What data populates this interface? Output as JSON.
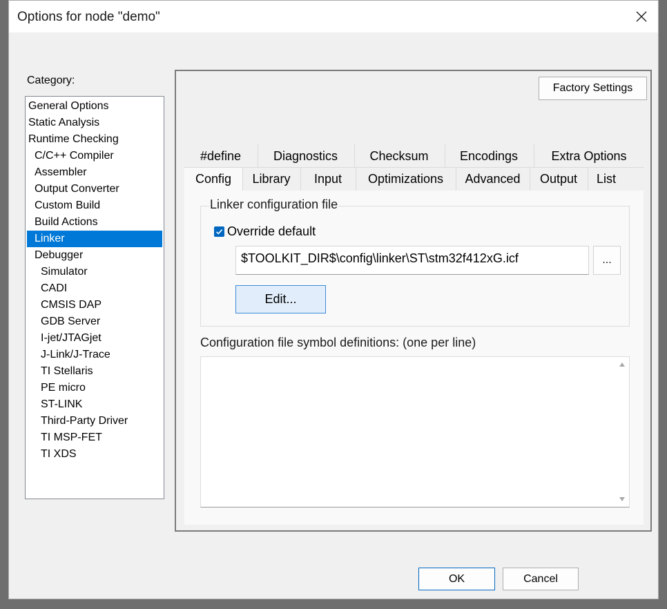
{
  "window": {
    "title": "Options for node \"demo\""
  },
  "category": {
    "label": "Category:",
    "items": [
      {
        "label": "General Options",
        "level": 0
      },
      {
        "label": "Static Analysis",
        "level": 0
      },
      {
        "label": "Runtime Checking",
        "level": 0
      },
      {
        "label": "C/C++ Compiler",
        "level": 1
      },
      {
        "label": "Assembler",
        "level": 1
      },
      {
        "label": "Output Converter",
        "level": 1
      },
      {
        "label": "Custom Build",
        "level": 1
      },
      {
        "label": "Build Actions",
        "level": 1
      },
      {
        "label": "Linker",
        "level": 1,
        "selected": true
      },
      {
        "label": "Debugger",
        "level": 1
      },
      {
        "label": "Simulator",
        "level": 2
      },
      {
        "label": "CADI",
        "level": 2
      },
      {
        "label": "CMSIS DAP",
        "level": 2
      },
      {
        "label": "GDB Server",
        "level": 2
      },
      {
        "label": "I-jet/JTAGjet",
        "level": 2
      },
      {
        "label": "J-Link/J-Trace",
        "level": 2
      },
      {
        "label": "TI Stellaris",
        "level": 2
      },
      {
        "label": "PE micro",
        "level": 2
      },
      {
        "label": "ST-LINK",
        "level": 2
      },
      {
        "label": "Third-Party Driver",
        "level": 2
      },
      {
        "label": "TI MSP-FET",
        "level": 2
      },
      {
        "label": "TI XDS",
        "level": 2
      }
    ]
  },
  "panel": {
    "factory_settings_label": "Factory Settings",
    "tabs_row1": [
      "#define",
      "Diagnostics",
      "Checksum",
      "Encodings",
      "Extra Options"
    ],
    "tabs_row2": [
      "Config",
      "Library",
      "Input",
      "Optimizations",
      "Advanced",
      "Output",
      "List"
    ],
    "active_tab": "Config",
    "config": {
      "group_title": "Linker configuration file",
      "override_label": "Override default",
      "override_checked": true,
      "path_value": "$TOOLKIT_DIR$\\config\\linker\\ST\\stm32f412xG.icf",
      "browse_label": "...",
      "edit_label": "Edit...",
      "symdef_label": "Configuration file symbol definitions: (one per line)",
      "symdef_value": ""
    }
  },
  "footer": {
    "ok_label": "OK",
    "cancel_label": "Cancel"
  },
  "colors": {
    "accent": "#0078d7",
    "checkbox": "#0067c0",
    "edit_button_bg": "#e1edfa"
  }
}
